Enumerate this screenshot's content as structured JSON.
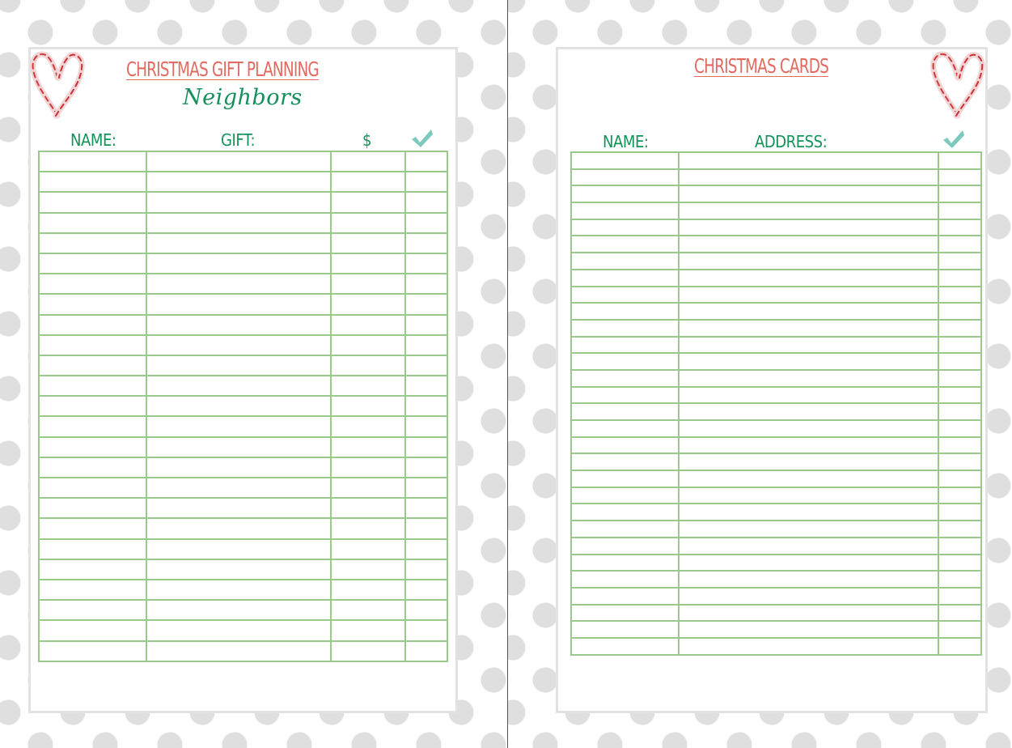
{
  "left_page": {
    "title": "CHRISTMAS GIFT PLANNING",
    "subtitle": "Neighbors",
    "columns": [
      "NAME:",
      "GIFT:",
      "$",
      "done"
    ],
    "check_icon": "checkmark-icon",
    "decoration": "candy-cane-heart",
    "row_count": 25
  },
  "right_page": {
    "title": "CHRISTMAS CARDS",
    "columns": [
      "NAME:",
      "ADDRESS:",
      "done"
    ],
    "check_icon": "checkmark-icon",
    "decoration": "candy-cane-heart",
    "row_count": 30
  },
  "colors": {
    "title": "#e26a60",
    "header": "#129358",
    "grid": "#9bc98b",
    "check": "#7cc9bd",
    "dots": "#dfdfdf",
    "panel_border": "#e2e2e2"
  }
}
